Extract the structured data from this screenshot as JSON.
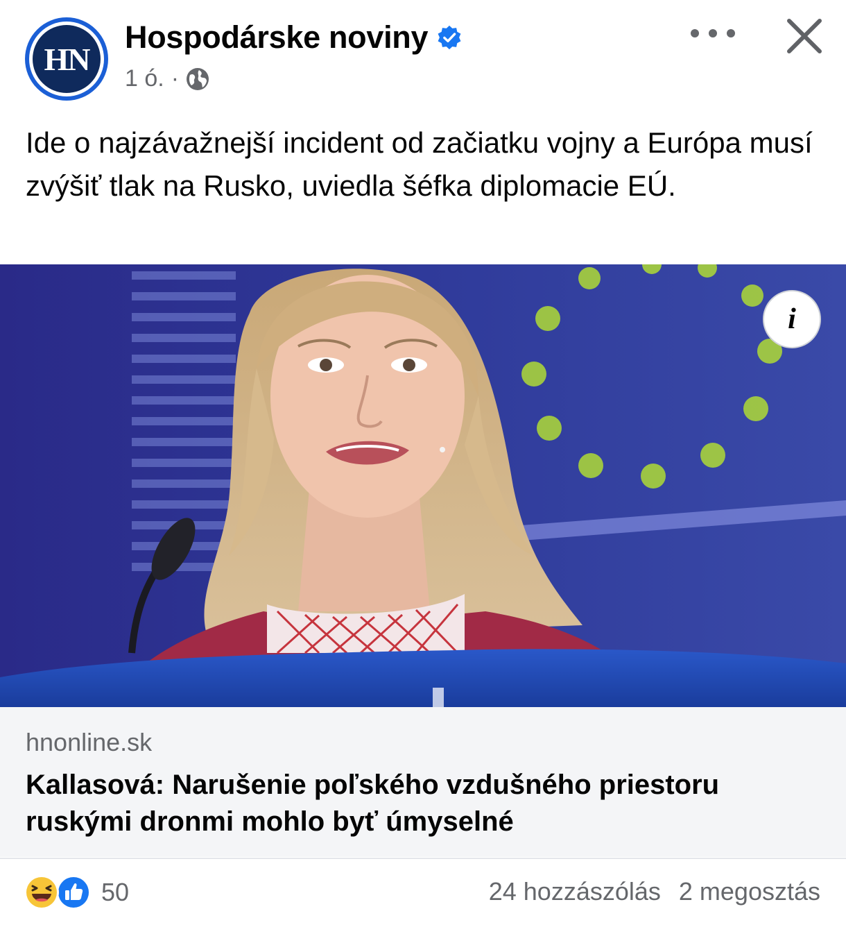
{
  "header": {
    "avatar_text": "HN",
    "page_name": "Hospodárske noviny",
    "timestamp": "1 ó.",
    "separator": "·",
    "more_label": "•••"
  },
  "post": {
    "caption": "Ide o najzávažnejší incident od začiatku vojny a Európa musí zvýšiť tlak na Rusko, uviedla šéfka diplomacie EÚ.",
    "info_label": "i"
  },
  "link": {
    "domain": "hnonline.sk",
    "title": "Kallasová: Narušenie poľského vzdušného priestoru ruskými dronmi mohlo byť úmyselné"
  },
  "footer": {
    "reaction_count": "50",
    "comments": "24 hozzászólás",
    "shares": "2 megosztás"
  },
  "colors": {
    "verified": "#1877f2",
    "avatar_ring": "#1b5fd6",
    "avatar_fill": "#0f2a5c",
    "muted_text": "#65676b",
    "link_bg": "#f4f5f7",
    "photo_backdrop": "#2a2f86",
    "eu_star": "#a8d23c"
  },
  "icons": {
    "verified": "verified-badge-icon",
    "audience": "globe-icon",
    "more": "more-options-icon",
    "close": "close-icon",
    "info": "info-icon",
    "reaction_1": "haha-reaction-icon",
    "reaction_2": "like-reaction-icon"
  }
}
